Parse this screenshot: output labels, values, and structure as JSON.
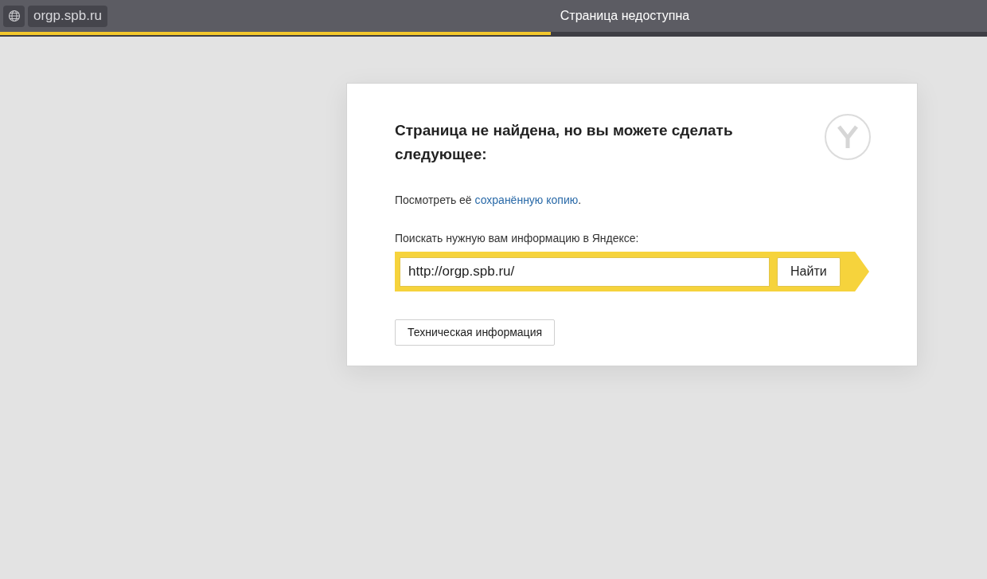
{
  "tab": {
    "site": "orgp.spb.ru",
    "title": "Страница недоступна"
  },
  "loading": {
    "level": 0.558
  },
  "card": {
    "heading": "Страница не найдена, но вы можете сделать следующее:",
    "copy_line": {
      "before": "Посмотреть её ",
      "link": "сохранённую копию",
      "after": "."
    },
    "search_label": "Поискать нужную вам информацию в Яндексе:",
    "search": {
      "value": "http://orgp.spb.ru/",
      "button": "Найти"
    },
    "tech_button": "Техническая информация"
  }
}
